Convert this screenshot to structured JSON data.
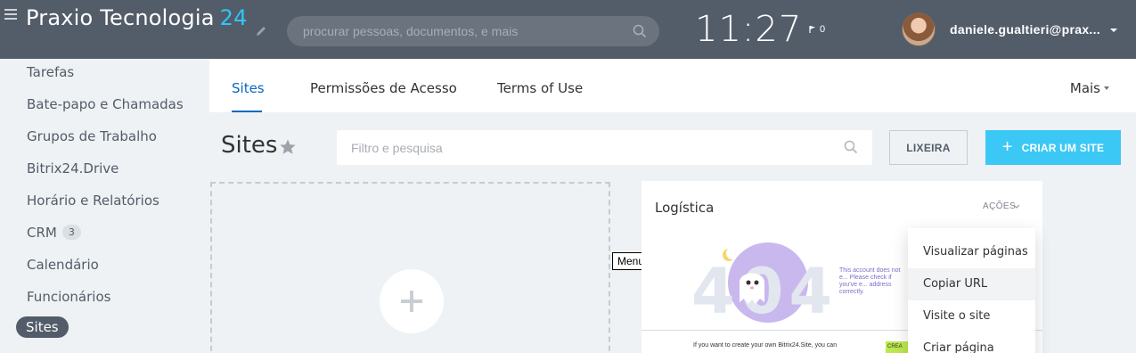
{
  "header": {
    "brand_name": "Praxio Tecnologia",
    "brand_number": "24",
    "search_placeholder": "procurar pessoas, documentos, e mais",
    "clock": "11:27",
    "flag_count": "0",
    "username": "daniele.gualtieri@prax...",
    "accent_color": "#2fc6f6"
  },
  "sidebar": {
    "items": [
      {
        "label": "Tarefas"
      },
      {
        "label": "Bate-papo e Chamadas"
      },
      {
        "label": "Grupos de Trabalho"
      },
      {
        "label": "Bitrix24.Drive"
      },
      {
        "label": "Horário e Relatórios"
      },
      {
        "label": "CRM",
        "badge": "3"
      },
      {
        "label": "Calendário"
      },
      {
        "label": "Funcionários"
      },
      {
        "label": "Sites",
        "active": true
      }
    ]
  },
  "tabs": {
    "items": [
      {
        "label": "Sites",
        "active": true
      },
      {
        "label": "Permissões de Acesso"
      },
      {
        "label": "Terms of Use"
      }
    ],
    "more_label": "Mais"
  },
  "main": {
    "title": "Sites",
    "filter_placeholder": "Filtro e pesquisa",
    "trash_label": "LIXEIRA",
    "create_label": "CRIAR UM SITE",
    "create_color": "#3bc8f5",
    "tooltip": "Menu"
  },
  "card": {
    "title": "Logística",
    "actions_label": "AÇÕES",
    "preview": {
      "code": "404",
      "message": "This account does not e... Please check if you've e... address correctly.",
      "footer_text": "If you want to create your own Bitrix24.Site, you can",
      "button": "CREA"
    }
  },
  "menu": {
    "items": [
      {
        "label": "Visualizar páginas"
      },
      {
        "label": "Copiar URL",
        "hover": true
      },
      {
        "label": "Visite o site"
      },
      {
        "label": "Criar página"
      }
    ]
  }
}
